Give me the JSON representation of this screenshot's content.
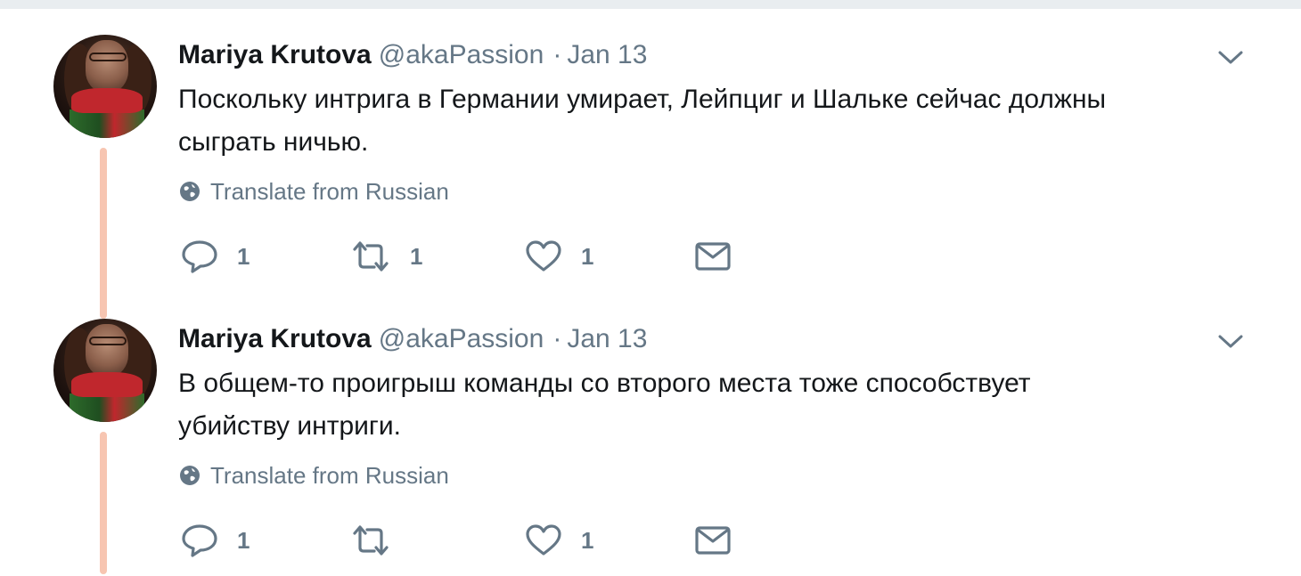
{
  "colors": {
    "thread_line": "#f7c5b1",
    "secondary_text": "#657786",
    "primary_text": "#14171a"
  },
  "tweets": [
    {
      "name": "Mariya Krutova",
      "handle": "@akaPassion",
      "separator": "·",
      "time": "Jan 13",
      "text_line1": "Поскольку интрига в Германии умирает, Лейпциг и Шальке сейчас должны",
      "text_line2": "сыграть ничью.",
      "translate_label": "Translate from Russian",
      "reply_count": "1",
      "retweet_count": "1",
      "like_count": "1",
      "icons": [
        "chevron-down-icon",
        "globe-icon",
        "reply-icon",
        "retweet-icon",
        "like-icon",
        "direct-message-icon"
      ]
    },
    {
      "name": "Mariya Krutova",
      "handle": "@akaPassion",
      "separator": "·",
      "time": "Jan 13",
      "text_line1": "В общем-то проигрыш команды со второго места тоже способствует",
      "text_line2": "убийству интриги.",
      "translate_label": "Translate from Russian",
      "reply_count": "1",
      "retweet_count": "",
      "like_count": "1",
      "icons": [
        "chevron-down-icon",
        "globe-icon",
        "reply-icon",
        "retweet-icon",
        "like-icon",
        "direct-message-icon"
      ]
    }
  ]
}
